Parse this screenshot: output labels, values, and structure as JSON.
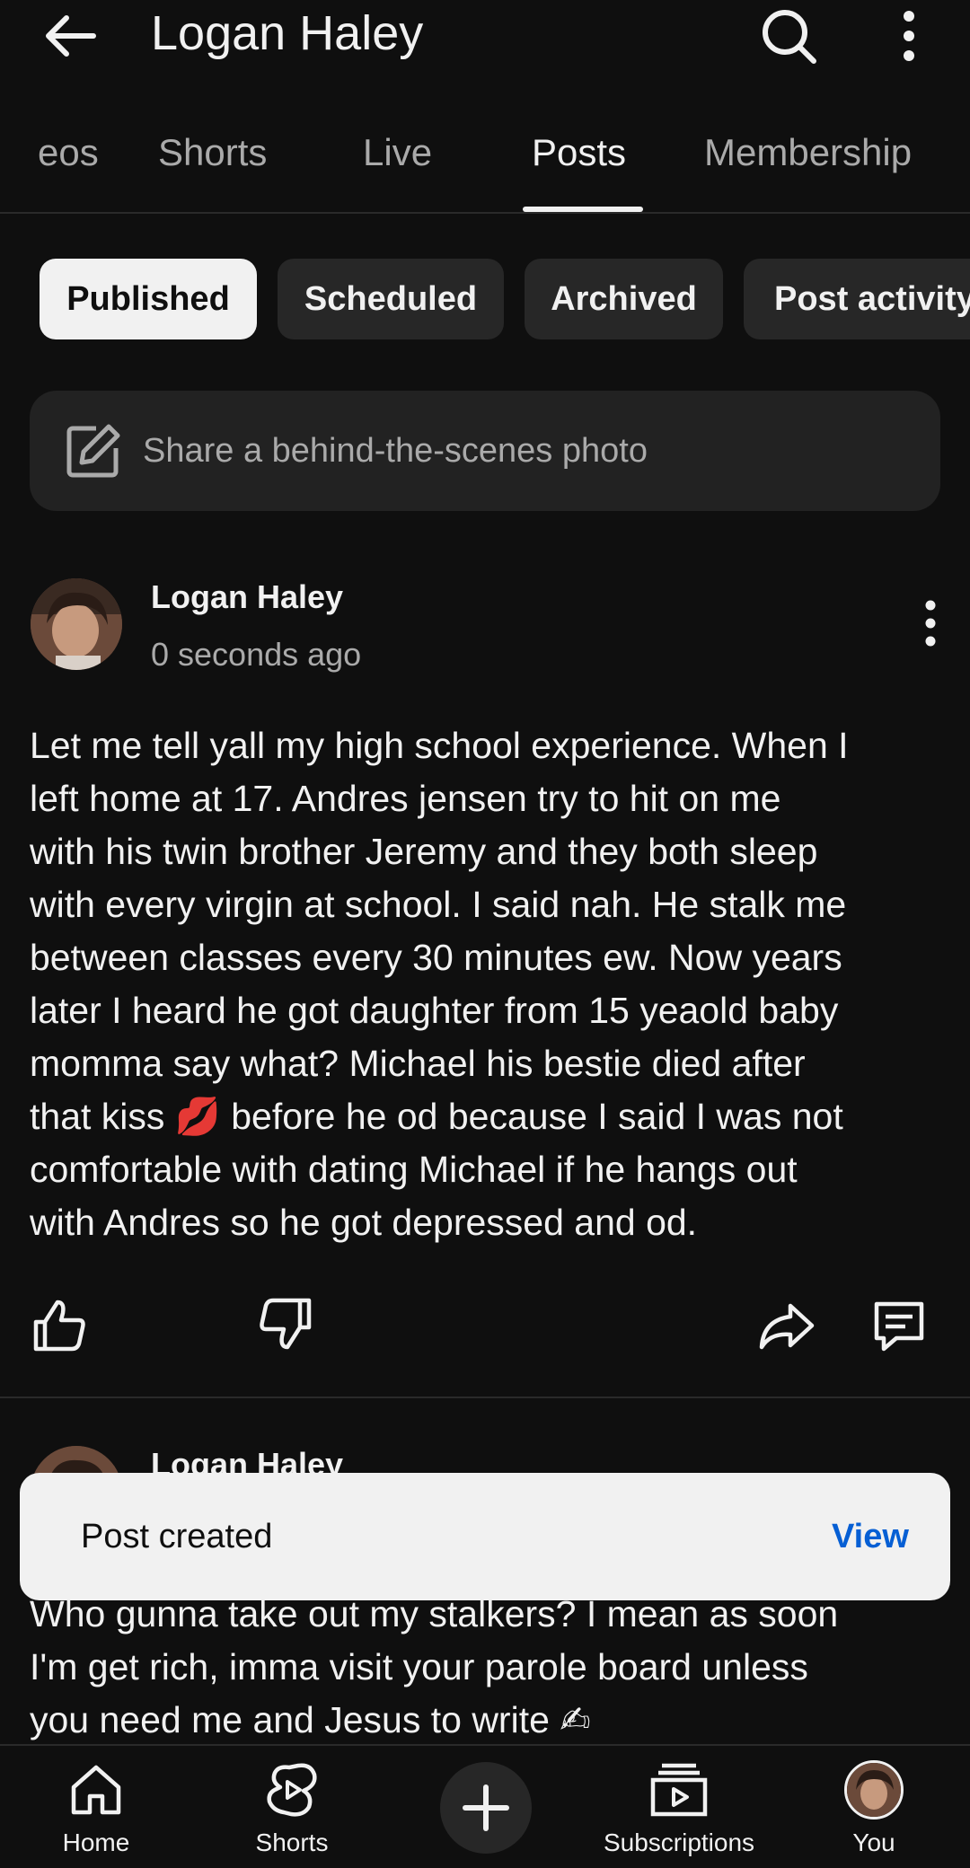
{
  "header": {
    "title": "Logan Haley"
  },
  "tabs": [
    {
      "label": "Videos",
      "visible": "eos"
    },
    {
      "label": "Shorts"
    },
    {
      "label": "Live"
    },
    {
      "label": "Posts",
      "active": true
    },
    {
      "label": "Membership"
    }
  ],
  "filters": [
    {
      "label": "Published",
      "selected": true
    },
    {
      "label": "Scheduled"
    },
    {
      "label": "Archived"
    },
    {
      "label": "Post activity"
    }
  ],
  "composer": {
    "placeholder": "Share a behind-the-scenes photo"
  },
  "posts": [
    {
      "author": "Logan Haley",
      "time": "0 seconds ago",
      "lines": [
        "Let me tell yall my high school experience.  When I",
        "left home at 17. Andres jensen try to hit on me",
        "with his twin brother Jeremy and they both sleep",
        "with every virgin at school. I said nah. He stalk me",
        "between classes every 30 minutes ew. Now years",
        "later I heard he got daughter from 15 yeaold baby",
        "momma say what? Michael his bestie died after",
        "that kiss 💋 before he od because I said I was not",
        "comfortable with dating Michael if he hangs out",
        "with Andres so he got depressed and od."
      ]
    },
    {
      "author": "Logan Haley",
      "lines": [
        "Who gunna take out my stalkers? I mean as soon",
        "I'm get rich, imma visit your parole board unless",
        "you need me and Jesus to write ✍"
      ]
    }
  ],
  "snackbar": {
    "message": "Post created",
    "action": "View"
  },
  "bottom_nav": [
    {
      "label": "Home",
      "icon": "home-icon"
    },
    {
      "label": "Shorts",
      "icon": "shorts-icon"
    },
    {
      "label": "",
      "icon": "plus-icon"
    },
    {
      "label": "Subscriptions",
      "icon": "subscriptions-icon"
    },
    {
      "label": "You",
      "icon": "avatar"
    }
  ],
  "colors": {
    "background": "#0f0f0f",
    "chip": "#272727",
    "selected_chip": "#f1f1f1",
    "link": "#065fd4"
  }
}
